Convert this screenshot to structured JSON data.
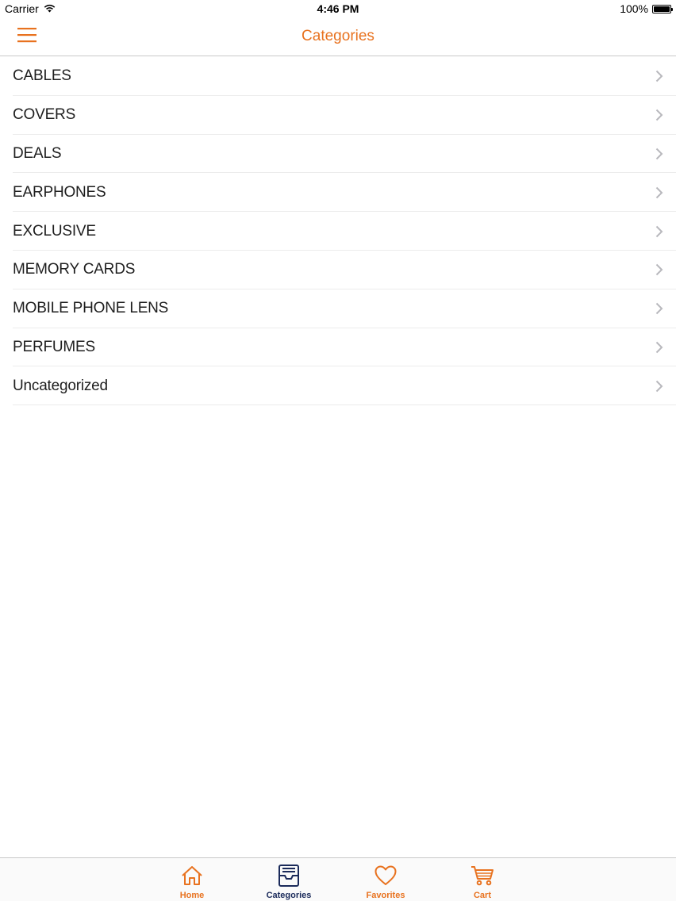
{
  "status_bar": {
    "carrier": "Carrier",
    "time": "4:46 PM",
    "battery": "100%"
  },
  "nav": {
    "title": "Categories",
    "menu_icon": "hamburger-menu-icon"
  },
  "categories": [
    {
      "label": "CABLES"
    },
    {
      "label": "COVERS"
    },
    {
      "label": "DEALS"
    },
    {
      "label": "EARPHONES"
    },
    {
      "label": "EXCLUSIVE"
    },
    {
      "label": "MEMORY CARDS"
    },
    {
      "label": "MOBILE PHONE LENS"
    },
    {
      "label": "PERFUMES"
    },
    {
      "label": "Uncategorized"
    }
  ],
  "tabs": [
    {
      "label": "Home",
      "icon": "home-icon"
    },
    {
      "label": "Categories",
      "icon": "inbox-tray-icon"
    },
    {
      "label": "Favorites",
      "icon": "heart-icon"
    },
    {
      "label": "Cart",
      "icon": "cart-icon"
    }
  ],
  "colors": {
    "accent": "#e8721f",
    "selected_tab": "#1a2a5a",
    "divider": "#ececec",
    "chevron": "#b8b8bd"
  }
}
